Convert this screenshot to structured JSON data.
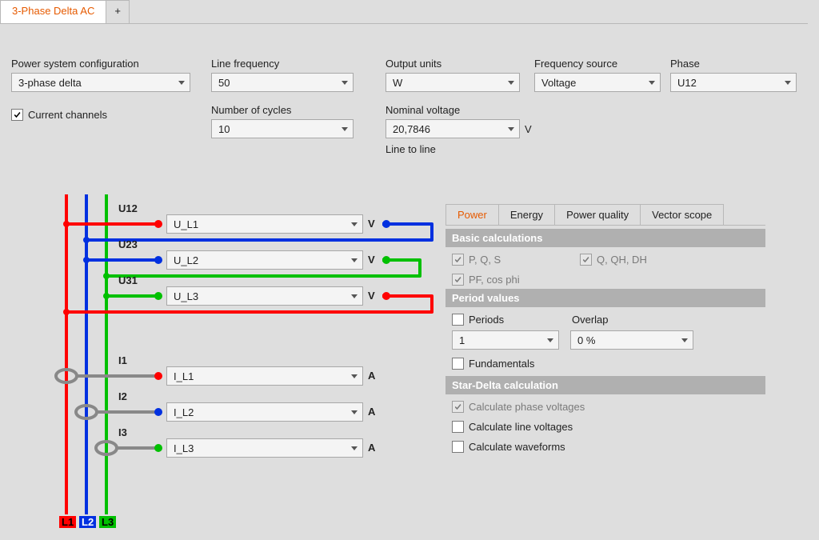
{
  "tabs": {
    "main_tab": "3-Phase Delta AC",
    "add_tab": "+"
  },
  "config": {
    "power_system_config": {
      "label": "Power system configuration",
      "value": "3-phase delta"
    },
    "line_frequency": {
      "label": "Line frequency",
      "value": "50"
    },
    "output_units": {
      "label": "Output units",
      "value": "W"
    },
    "frequency_source": {
      "label": "Frequency source",
      "value": "Voltage"
    },
    "phase": {
      "label": "Phase",
      "value": "U12"
    },
    "number_of_cycles": {
      "label": "Number of cycles",
      "value": "10"
    },
    "nominal_voltage": {
      "label": "Nominal voltage",
      "value": "20,7846",
      "unit": "V",
      "sub": "Line to line"
    },
    "current_channels": {
      "label": "Current channels"
    }
  },
  "wiring": {
    "u12": {
      "label": "U12",
      "value": "U_L1",
      "unit": "V"
    },
    "u23": {
      "label": "U23",
      "value": "U_L2",
      "unit": "V"
    },
    "u31": {
      "label": "U31",
      "value": "U_L3",
      "unit": "V"
    },
    "i1": {
      "label": "I1",
      "value": "I_L1",
      "unit": "A"
    },
    "i2": {
      "label": "I2",
      "value": "I_L2",
      "unit": "A"
    },
    "i3": {
      "label": "I3",
      "value": "I_L3",
      "unit": "A"
    },
    "legend": {
      "l1": "L1",
      "l2": "L2",
      "l3": "L3"
    }
  },
  "right": {
    "tabs": {
      "power": "Power",
      "energy": "Energy",
      "pq": "Power quality",
      "vs": "Vector scope"
    },
    "basic_hdr": "Basic calculations",
    "pqs": "P, Q, S",
    "qqhdh": "Q, QH, DH",
    "pfcos": "PF, cos phi",
    "period_hdr": "Period values",
    "periods_cb": "Periods",
    "overlap_label": "Overlap",
    "period_sel": "1",
    "overlap_sel": "0 %",
    "fundamentals_cb": "Fundamentals",
    "sd_hdr": "Star-Delta calculation",
    "calc_phase": "Calculate phase voltages",
    "calc_line": "Calculate line voltages",
    "calc_wav": "Calculate waveforms"
  }
}
